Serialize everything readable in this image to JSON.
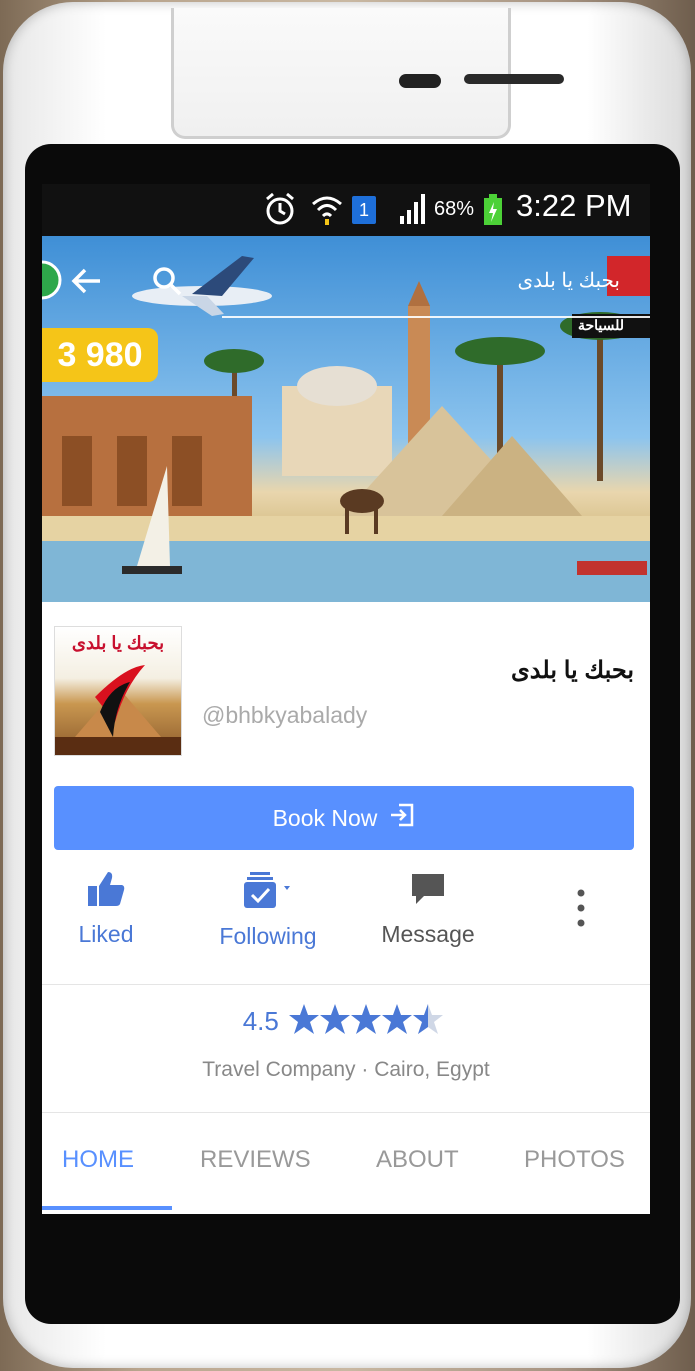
{
  "status_bar": {
    "battery": "68%",
    "time": "3:22 PM",
    "sim_badge": "1"
  },
  "cover": {
    "page_title": "بحبك يا بلدى",
    "logo_caption": "للسياحة",
    "price_badge": "3 980"
  },
  "profile": {
    "name": "بحبك يا بلدى",
    "handle": "@bhbkyabalady",
    "avatar_text": "بحبك يا بلدى"
  },
  "book_button": {
    "label": "Book Now"
  },
  "actions": [
    {
      "label": "Liked",
      "color": "#4a78d6"
    },
    {
      "label": "Following",
      "color": "#4a78d6"
    },
    {
      "label": "Message",
      "color": "#555555"
    }
  ],
  "rating": {
    "value": "4.5",
    "stars": 4.5,
    "max_stars": 5,
    "category": "Travel Company · Cairo, Egypt"
  },
  "tabs": [
    {
      "label": "HOME",
      "active": true
    },
    {
      "label": "REVIEWS",
      "active": false
    },
    {
      "label": "ABOUT",
      "active": false
    },
    {
      "label": "PHOTOS",
      "active": false
    }
  ],
  "colors": {
    "accent": "#5890ff",
    "price_badge": "#f5c518"
  }
}
